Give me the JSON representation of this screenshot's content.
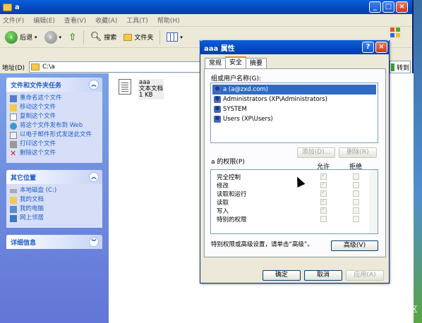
{
  "explorer": {
    "title": "a",
    "menu": [
      "文件(F)",
      "编辑(E)",
      "查看(V)",
      "收藏(A)",
      "工具(T)",
      "帮助(H)"
    ],
    "toolbar": {
      "back": "后退",
      "search": "搜索",
      "folders": "文件夹"
    },
    "address": {
      "label": "地址(D)",
      "value": "C:\\a",
      "go": "转到"
    },
    "tasks_panel": {
      "title": "文件和文件夹任务",
      "items": [
        "重命名这个文件",
        "移动这个文件",
        "复制这个文件",
        "将这个文件发布到 Web",
        "以电子邮件形式发送此文件",
        "打印这个文件",
        "删除这个文件"
      ]
    },
    "other_panel": {
      "title": "其它位置",
      "items": [
        "本地磁盘 (C:)",
        "我的文档",
        "我的电脑",
        "网上邻居"
      ]
    },
    "details_panel": {
      "title": "详细信息"
    },
    "file": {
      "name": "aaa",
      "type": "文本文档",
      "size": "1 KB"
    }
  },
  "dialog": {
    "title": "aaa 属性",
    "tabs": [
      "常规",
      "安全",
      "摘要"
    ],
    "active_tab": "安全",
    "users_label": "组或用户名称(G):",
    "users": [
      "a (a@zxd.com)",
      "Administrators (XP\\Administrators)",
      "SYSTEM",
      "Users (XP\\Users)"
    ],
    "add_button": "添加(D)...",
    "remove_button": "删除(R)",
    "perm_label": "a 的权限(P)",
    "allow_header": "允许",
    "deny_header": "拒绝",
    "permissions": [
      {
        "name": "完全控制",
        "allow": true
      },
      {
        "name": "修改",
        "allow": true
      },
      {
        "name": "读取和运行",
        "allow": true
      },
      {
        "name": "读取",
        "allow": true
      },
      {
        "name": "写入",
        "allow": true
      },
      {
        "name": "特别的权限",
        "allow": false
      }
    ],
    "advanced_text": "特别权限或高级设置，请单击“高级”。",
    "advanced_button": "高级(V)",
    "ok_button": "确定",
    "cancel_button": "取消",
    "apply_button": "应用(A)"
  },
  "watermark": "@稀土掘金技术社区"
}
